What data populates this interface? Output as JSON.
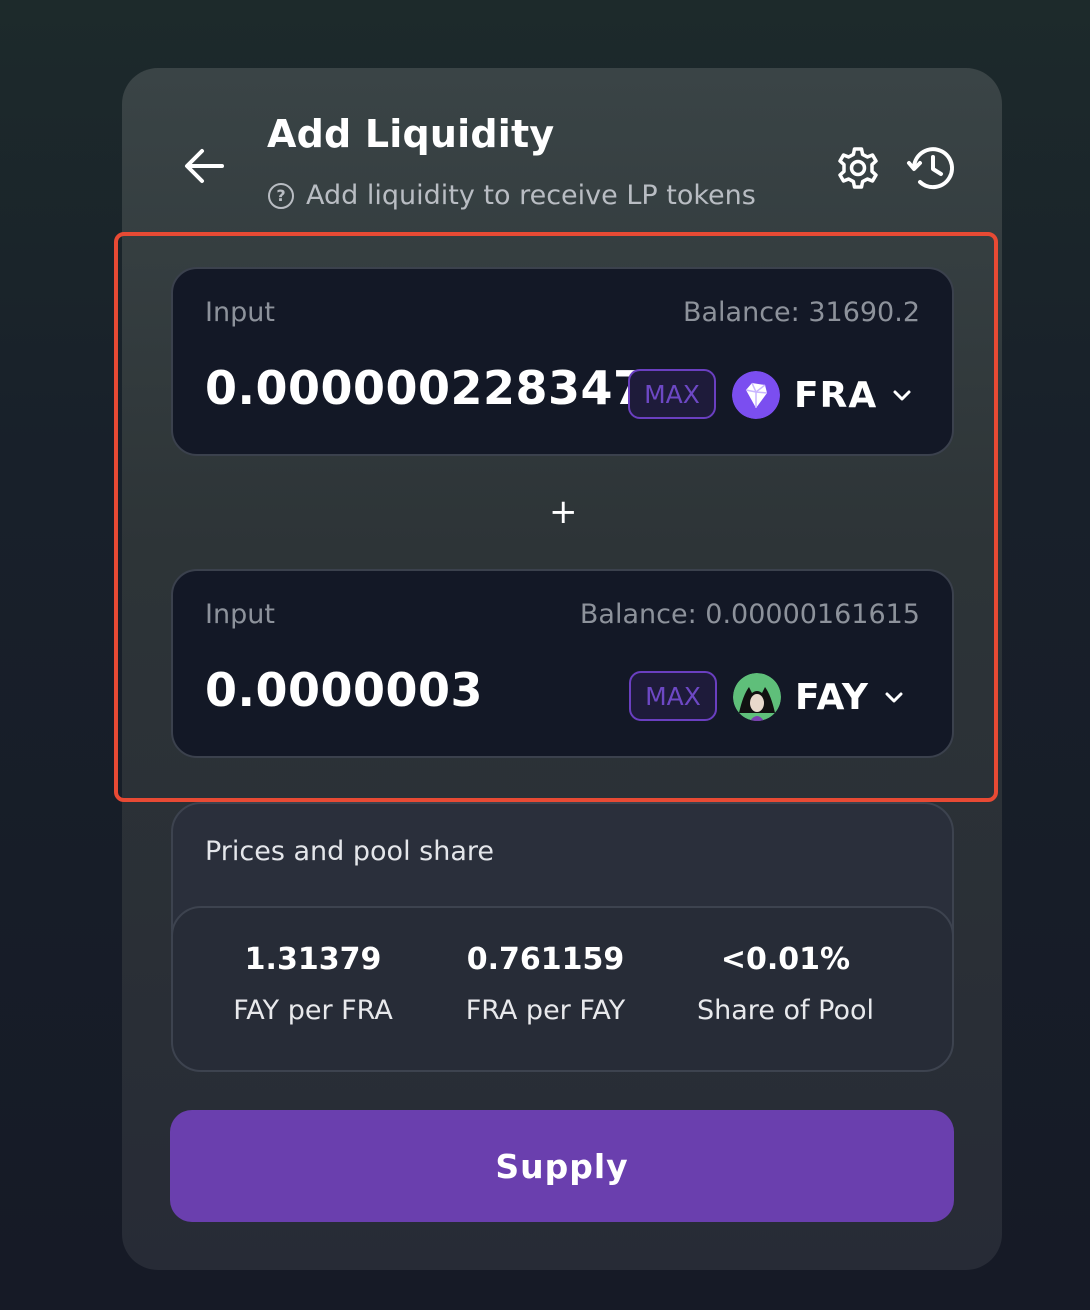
{
  "header": {
    "title": "Add Liquidity",
    "subtitle": "Add liquidity to receive LP tokens"
  },
  "inputs": [
    {
      "label": "Input",
      "balance": "Balance: 31690.2",
      "amount": "0.000000228347",
      "max_label": "MAX",
      "token": "FRA",
      "token_icon": "fra-logo-icon"
    },
    {
      "label": "Input",
      "balance": "Balance: 0.00000161615",
      "amount": "0.0000003",
      "max_label": "MAX",
      "token": "FAY",
      "token_icon": "fay-logo-icon"
    }
  ],
  "plus_sign": "+",
  "prices": {
    "heading": "Prices and pool share",
    "stats": [
      {
        "value": "1.31379",
        "label": "FAY per FRA"
      },
      {
        "value": "0.761159",
        "label": "FRA per FAY"
      },
      {
        "value": "<0.01%",
        "label": "Share of Pool"
      }
    ]
  },
  "supply_label": "Supply",
  "colors": {
    "accent": "#6a3fae",
    "max_border": "#6a3fc0",
    "highlight": "#e84a34",
    "input_bg": "#131826"
  }
}
